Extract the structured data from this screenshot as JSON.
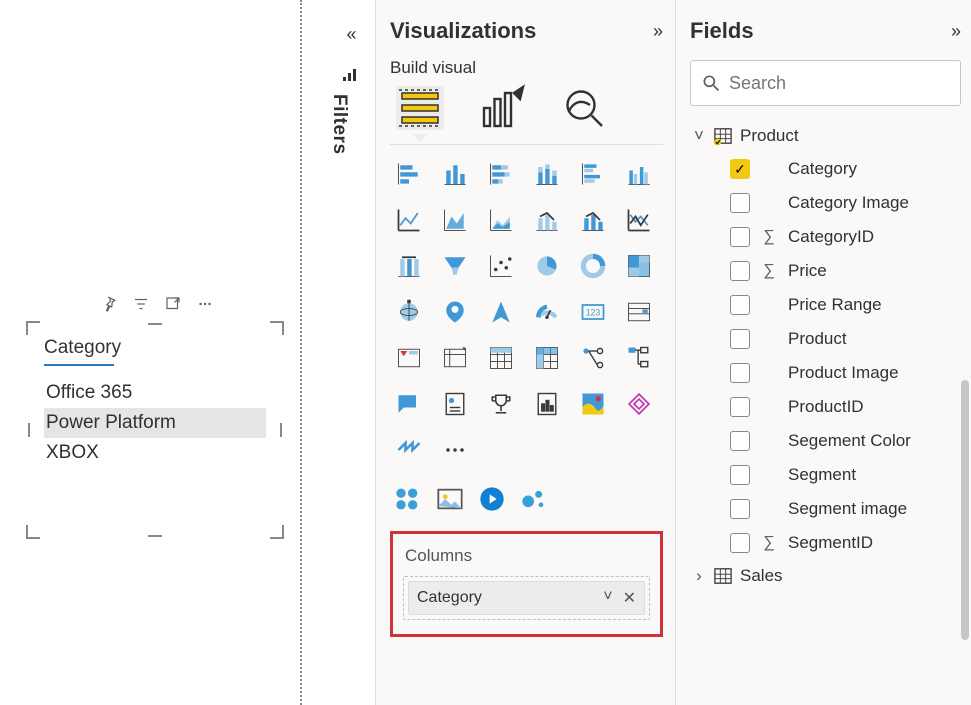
{
  "slicer": {
    "title": "Category",
    "items": [
      "Office 365",
      "Power Platform",
      "XBOX"
    ],
    "selected_index": 1
  },
  "filters_strip": {
    "label": "Filters"
  },
  "visualizations": {
    "title": "Visualizations",
    "subtitle": "Build visual",
    "more_label": "···",
    "drop": {
      "label": "Columns",
      "field": "Category"
    }
  },
  "fields": {
    "title": "Fields",
    "search_placeholder": "Search",
    "tables": [
      {
        "name": "Product",
        "expanded": true,
        "columns": [
          {
            "name": "Category",
            "checked": true,
            "sigma": false
          },
          {
            "name": "Category Image",
            "checked": false,
            "sigma": false
          },
          {
            "name": "CategoryID",
            "checked": false,
            "sigma": true
          },
          {
            "name": "Price",
            "checked": false,
            "sigma": true
          },
          {
            "name": "Price Range",
            "checked": false,
            "sigma": false
          },
          {
            "name": "Product",
            "checked": false,
            "sigma": false
          },
          {
            "name": "Product Image",
            "checked": false,
            "sigma": false
          },
          {
            "name": "ProductID",
            "checked": false,
            "sigma": false
          },
          {
            "name": "Segement Color",
            "checked": false,
            "sigma": false
          },
          {
            "name": "Segment",
            "checked": false,
            "sigma": false
          },
          {
            "name": "Segment image",
            "checked": false,
            "sigma": false
          },
          {
            "name": "SegmentID",
            "checked": false,
            "sigma": true
          }
        ]
      },
      {
        "name": "Sales",
        "expanded": false,
        "columns": []
      }
    ]
  }
}
